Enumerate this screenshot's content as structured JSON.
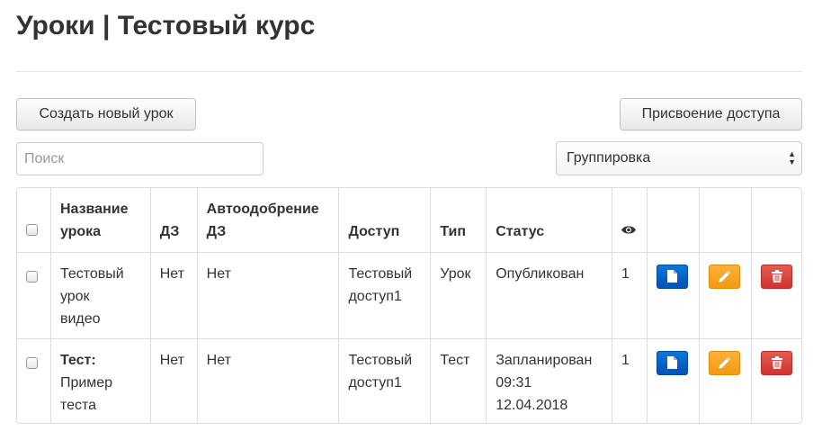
{
  "page": {
    "title": "Уроки | Тестовый курс"
  },
  "toolbar": {
    "create_label": "Создать новый урок",
    "access_label": "Присвоение доступа",
    "search_placeholder": "Поиск",
    "grouping_value": "Группировка"
  },
  "table": {
    "headers": {
      "name_line1": "Название",
      "name_line2": "урока",
      "hw": "ДЗ",
      "auto_line1": "Автоодобрение",
      "auto_line2": "ДЗ",
      "access": "Доступ",
      "type": "Тип",
      "status": "Статус",
      "views_icon": "eye-icon"
    },
    "rows": [
      {
        "name_lines": [
          "Тестовый",
          "урок",
          "видео"
        ],
        "name_prefix": "",
        "hw": "Нет",
        "auto": "Нет",
        "access_lines": [
          "Тестовый",
          "доступ1"
        ],
        "type": "Урок",
        "status_lines": [
          "Опубликован"
        ],
        "views": "1",
        "actions": [
          "file-icon",
          "pencil-icon",
          "trash-icon"
        ]
      },
      {
        "name_lines": [
          "Пример",
          "теста"
        ],
        "name_prefix": "Тест:",
        "hw": "Нет",
        "auto": "Нет",
        "access_lines": [
          "Тестовый",
          "доступ1"
        ],
        "type": "Тест",
        "status_lines": [
          "Запланирован",
          "09:31",
          "12.04.2018"
        ],
        "views": "1",
        "actions": [
          "file-icon",
          "pencil-icon",
          "trash-icon"
        ]
      }
    ]
  },
  "colors": {
    "view_button": "#0062cc",
    "edit_button": "#f6a623",
    "delete_button": "#d9403c"
  }
}
